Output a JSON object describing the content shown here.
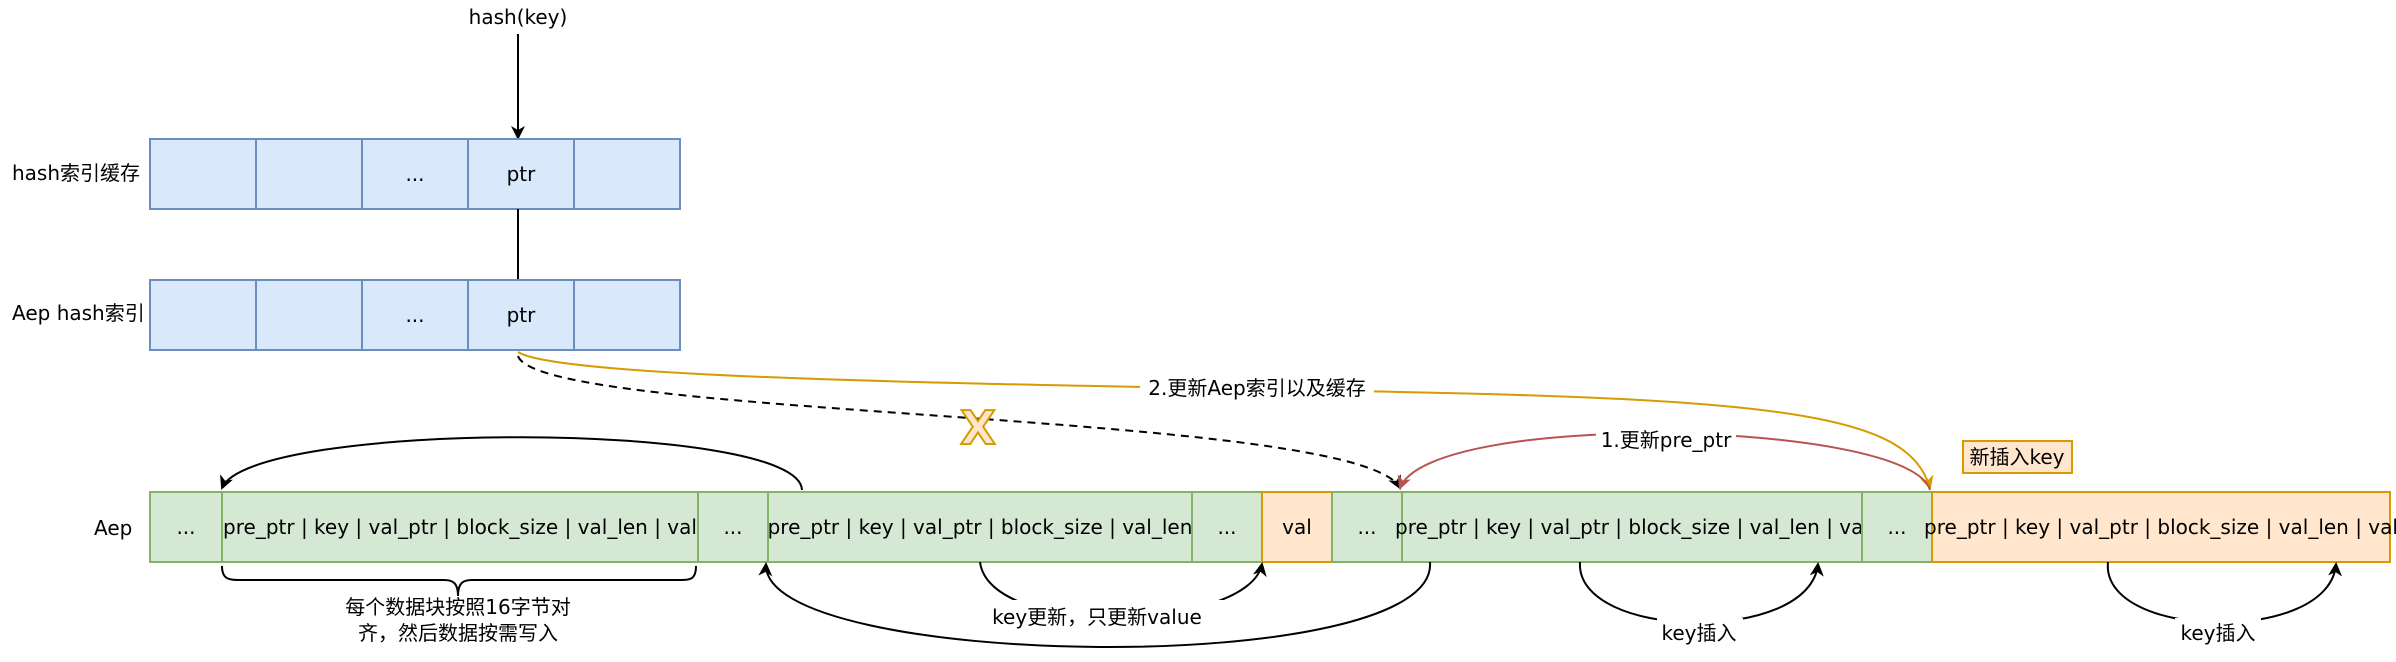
{
  "hash_key_label": "hash(key)",
  "row_labels": {
    "hash_cache": "hash索引缓存",
    "aep_hash": "Aep hash索引",
    "aep": "Aep"
  },
  "hash_cache_cells": [
    "",
    "",
    "...",
    "ptr",
    ""
  ],
  "aep_hash_cells": [
    "",
    "",
    "...",
    "ptr",
    ""
  ],
  "aep_cells": [
    {
      "text": "...",
      "kind": "green"
    },
    {
      "text": "pre_ptr | key | val_ptr | block_size | val_len | val",
      "kind": "green"
    },
    {
      "text": "...",
      "kind": "green"
    },
    {
      "text": "pre_ptr | key | val_ptr | block_size | val_len",
      "kind": "green"
    },
    {
      "text": "...",
      "kind": "green"
    },
    {
      "text": "val",
      "kind": "orange"
    },
    {
      "text": "...",
      "kind": "green"
    },
    {
      "text": "pre_ptr | key | val_ptr | block_size | val_len | val",
      "kind": "green"
    },
    {
      "text": "...",
      "kind": "green"
    },
    {
      "text": "pre_ptr | key | val_ptr | block_size | val_len | val",
      "kind": "orange"
    }
  ],
  "annotations": {
    "update_aep_index": "2.更新Aep索引以及缓存",
    "update_pre_ptr": "1.更新pre_ptr",
    "new_key": "新插入key",
    "cross_mark": "X",
    "align_note_line1": "每个数据块按照16字节对",
    "align_note_line2": "齐，然后数据按需写入",
    "value_update_note": "key更新，只更新value",
    "key_insert_1": "key插入",
    "key_insert_2": "key插入"
  },
  "colors": {
    "blue_fill": "#dae8fc",
    "blue_stroke": "#6c8ebf",
    "green_fill": "#d5e8d4",
    "green_stroke": "#82b366",
    "orange_fill": "#ffe6cc",
    "orange_stroke": "#d79b00",
    "red_arrow": "#b85450",
    "gold_arrow": "#d79b00"
  }
}
